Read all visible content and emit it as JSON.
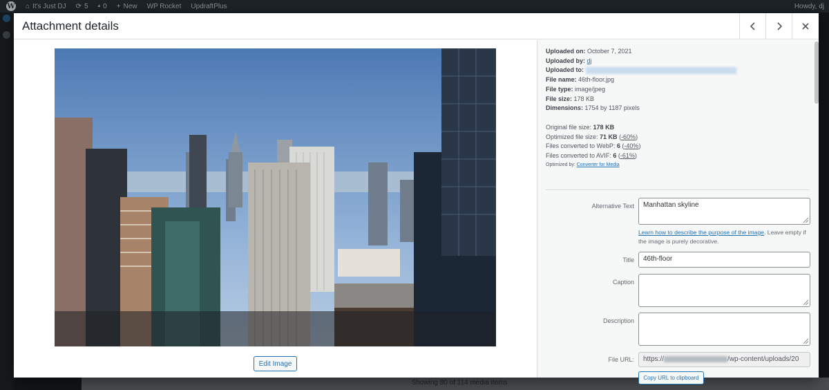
{
  "adminbar": {
    "site_name": "It's Just DJ",
    "updates_count": "5",
    "comments_count": "0",
    "new_label": "New",
    "wp_rocket_label": "WP Rocket",
    "updraft_label": "UpdraftPlus",
    "howdy": "Howdy, dj"
  },
  "modal": {
    "title": "Attachment details",
    "edit_image_label": "Edit Image"
  },
  "meta": {
    "uploaded_on_label": "Uploaded on:",
    "uploaded_on": "October 7, 2021",
    "uploaded_by_label": "Uploaded by:",
    "uploaded_by": "dj",
    "uploaded_to_label": "Uploaded to:",
    "file_name_label": "File name:",
    "file_name": "46th-floor.jpg",
    "file_type_label": "File type:",
    "file_type": "image/jpeg",
    "file_size_label": "File size:",
    "file_size": "178 KB",
    "dimensions_label": "Dimensions:",
    "dimensions": "1754 by 1187 pixels"
  },
  "optimization": {
    "original_label": "Original file size:",
    "original": "178 KB",
    "optimized_label": "Optimized file size:",
    "optimized": "71 KB",
    "optimized_pct": "-60%",
    "webp_label": "Files converted to WebP:",
    "webp": "6",
    "webp_pct": "-40%",
    "avif_label": "Files converted to AVIF:",
    "avif": "6",
    "avif_pct": "-61%",
    "by_label": "Optimized by:",
    "by_link": "Converter for Media"
  },
  "fields": {
    "alt_label": "Alternative Text",
    "alt_value": "Manhattan skyline",
    "alt_help_link": "Learn how to describe the purpose of the image",
    "alt_help_rest": ". Leave empty if the image is purely decorative.",
    "title_label": "Title",
    "title_value": "46th-floor",
    "caption_label": "Caption",
    "caption_value": "",
    "description_label": "Description",
    "description_value": "",
    "url_label": "File URL:",
    "url_prefix": "https://",
    "url_suffix": "/wp-content/uploads/20",
    "copy_label": "Copy URL to clipboard"
  },
  "background": {
    "status": "Showing 80 of 114 media items"
  }
}
